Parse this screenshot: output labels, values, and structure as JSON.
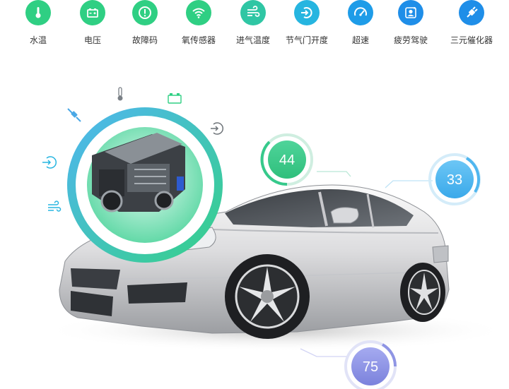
{
  "features": [
    {
      "label": "水温",
      "icon": "thermometer-icon",
      "color": "#2fcf83"
    },
    {
      "label": "电压",
      "icon": "battery-icon",
      "color": "#2fcf83"
    },
    {
      "label": "故障码",
      "icon": "alert-icon",
      "color": "#2fcf83"
    },
    {
      "label": "氧传感器",
      "icon": "wifi-icon",
      "color": "#2fcf83"
    },
    {
      "label": "进气温度",
      "icon": "air-flow-icon",
      "color": "#2fc6a4"
    },
    {
      "label": "节气门开度",
      "icon": "throttle-icon",
      "color": "#26b5e0"
    },
    {
      "label": "超速",
      "icon": "speedometer-icon",
      "color": "#1e9ce8"
    },
    {
      "label": "疲劳驾驶",
      "icon": "sleeping-driver-icon",
      "color": "#1f8ee8"
    },
    {
      "label": "三元催化器",
      "icon": "catalytic-plug-icon",
      "color": "#1f8ee8"
    }
  ],
  "badges": {
    "left": "44",
    "right": "33",
    "bottom": "75"
  },
  "colors": {
    "green": "#36c98b",
    "blue": "#4fb6ef",
    "purple": "#8f95e4"
  }
}
